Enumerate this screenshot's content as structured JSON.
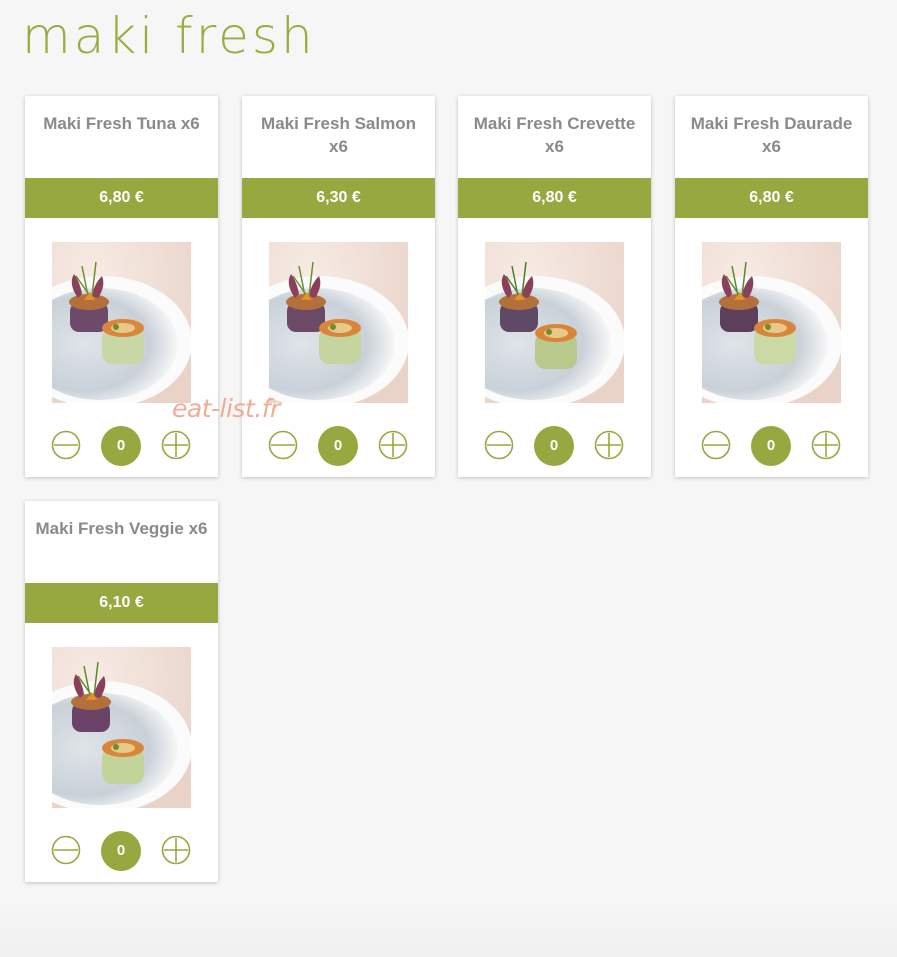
{
  "page": {
    "title": "maki fresh",
    "accent_color": "#96a83f"
  },
  "watermark": "eat-list.fr",
  "products": [
    {
      "name": "Maki Fresh Tuna x6",
      "price": "6,80 €",
      "quantity": "0",
      "image": "maki-fresh-tuna-photo"
    },
    {
      "name": "Maki Fresh Salmon x6",
      "price": "6,30 €",
      "quantity": "0",
      "image": "maki-fresh-salmon-photo"
    },
    {
      "name": "Maki Fresh Crevette x6",
      "price": "6,80 €",
      "quantity": "0",
      "image": "maki-fresh-crevette-photo"
    },
    {
      "name": "Maki Fresh Daurade x6",
      "price": "6,80 €",
      "quantity": "0",
      "image": "maki-fresh-daurade-photo"
    },
    {
      "name": "Maki Fresh Veggie x6",
      "price": "6,10 €",
      "quantity": "0",
      "image": "maki-fresh-veggie-photo"
    }
  ],
  "icons": {
    "decrease": "minus-circle-icon",
    "increase": "plus-circle-icon"
  }
}
